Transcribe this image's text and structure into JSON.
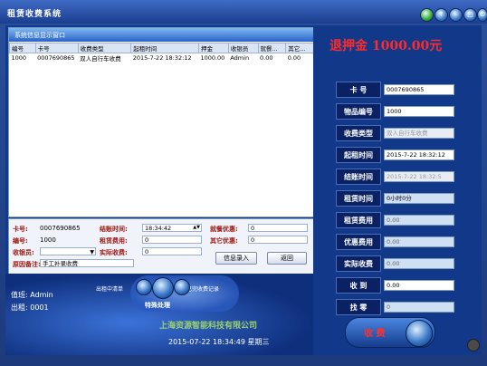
{
  "window": {
    "title": "租赁收费系统"
  },
  "title_buttons": [
    "green-circle-icon",
    "help-icon",
    "minimize-icon",
    "maximize-icon",
    "power-icon"
  ],
  "grid": {
    "title": "系统信息显示窗口",
    "columns": [
      "编号",
      "卡号",
      "收费类型",
      "起租时间",
      "押金",
      "收银员",
      "就餐...",
      "其它..."
    ],
    "rows": [
      [
        "1000",
        "0007690865",
        "双人自行车收费",
        "2015-7-22 18:32:12",
        "1000.00",
        "Admin",
        "0.00",
        "0.00"
      ]
    ]
  },
  "form": {
    "card_label": "卡号:",
    "card_value": "0007690865",
    "id_label": "编号:",
    "id_value": "1000",
    "cashier_label": "收银员:",
    "cashier_value": "",
    "remark_label": "原因备注:",
    "remark_value": "手工补录收费",
    "end_time_label": "结账时间:",
    "end_time_value": "18:34:42",
    "rent_fee_label": "租赁费用:",
    "rent_fee_value": "0",
    "actual_label": "实际收费:",
    "actual_value": "0",
    "meal_label": "就餐优惠:",
    "meal_value": "0",
    "other_label": "其它优惠:",
    "other_value": "0",
    "record_button": "信息录入",
    "back_button": "返回"
  },
  "bottom": {
    "left_nav": "出租中清单",
    "right_nav": "已完收费记录",
    "center_label": "特殊处理",
    "duty": "值班: Admin",
    "counter": "出租: 0001",
    "company": "上海资源智能科技有限公司",
    "datetime": "2015-07-22  18:34:49  星期三"
  },
  "right": {
    "deposit": "退押金 1000.00元",
    "fields": [
      {
        "label": "卡    号",
        "value": "0007690865",
        "disabled": false
      },
      {
        "label": "物品编号",
        "value": "1000",
        "disabled": false
      },
      {
        "label": "收费类型",
        "value": "双人自行车收费",
        "disabled": true
      },
      {
        "label": "起租时间",
        "value": "2015-7-22 18:32:12",
        "disabled": false
      },
      {
        "label": "结账时间",
        "value": "2015-7-22 18:32:5",
        "disabled": true
      },
      {
        "label": "租赁时间",
        "value": "0小时0分",
        "disabled": false
      },
      {
        "label": "租赁费用",
        "value": "0.00",
        "disabled": true
      },
      {
        "label": "优惠费用",
        "value": "0.00",
        "disabled": true
      },
      {
        "label": "实际收费",
        "value": "0.00",
        "disabled": true
      },
      {
        "label": "收    到",
        "value": "0.00",
        "disabled": false
      },
      {
        "label": "找    零",
        "value": "0",
        "disabled": true
      }
    ],
    "charge_button": "收 费"
  }
}
